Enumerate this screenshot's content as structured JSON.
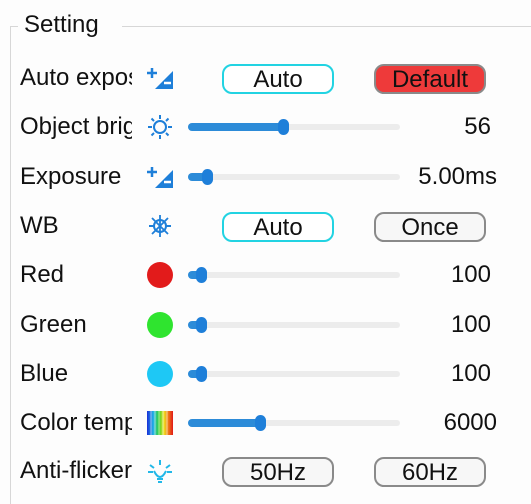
{
  "group_title": "Setting",
  "rows": {
    "auto_exposure": {
      "label": "Auto exposure",
      "icon": "exposure-plus-minus-icon",
      "btn_auto": "Auto",
      "btn_default": "Default"
    },
    "object_brightness": {
      "label": "Object brightness",
      "icon": "brightness-sun-icon",
      "value": "56",
      "level": 0.45
    },
    "exposure": {
      "label": "Exposure",
      "icon": "exposure-plus-minus-icon",
      "value": "5.00ms",
      "level": 0.09
    },
    "wb": {
      "label": "WB",
      "icon": "white-balance-icon",
      "btn_auto": "Auto",
      "btn_once": "Once"
    },
    "red": {
      "label": "Red",
      "icon": "red-dot-icon",
      "value": "100",
      "level": 0.06,
      "color": "#e21b1b"
    },
    "green": {
      "label": "Green",
      "icon": "green-dot-icon",
      "value": "100",
      "level": 0.06,
      "color": "#2fe42f"
    },
    "blue": {
      "label": "Blue",
      "icon": "blue-dot-icon",
      "value": "100",
      "level": 0.06,
      "color": "#1ec8f5"
    },
    "color_temperature": {
      "label": "Color temperature",
      "icon": "color-spectrum-icon",
      "value": "6000",
      "level": 0.34
    },
    "anti_flicker": {
      "label": "Anti-flicker",
      "icon": "light-bulb-icon",
      "btn_50": "50Hz",
      "btn_60": "60Hz"
    }
  },
  "colors": {
    "accent": "#22d3e2",
    "slider": "#1e7fd9",
    "default_button": "#ee3a3a"
  }
}
